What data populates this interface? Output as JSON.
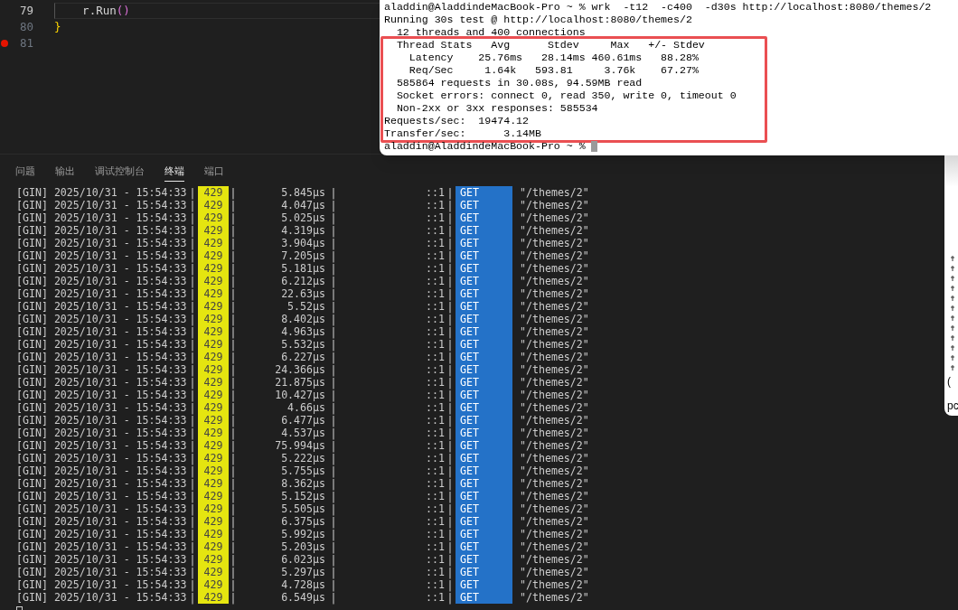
{
  "editor": {
    "lines": [
      {
        "number": "79",
        "current": true,
        "breakpoint": false,
        "tokens": [
          {
            "text": "    r.Run",
            "kind": "plain"
          },
          {
            "text": "()",
            "kind": "paren"
          }
        ]
      },
      {
        "number": "80",
        "current": false,
        "breakpoint": false,
        "tokens": [
          {
            "text": "}",
            "kind": "brace"
          }
        ]
      },
      {
        "number": "81",
        "current": false,
        "breakpoint": true
      }
    ]
  },
  "panel": {
    "tabs": [
      {
        "label": "问题",
        "selected": false
      },
      {
        "label": "输出",
        "selected": false
      },
      {
        "label": "调试控制台",
        "selected": false
      },
      {
        "label": "终端",
        "selected": true
      },
      {
        "label": "端口",
        "selected": false
      }
    ],
    "separator": "|",
    "log": [
      {
        "prefix": "[GIN] 2025/10/31 - 15:54:33",
        "status": "429",
        "latency": "5.845µs",
        "client": "::1",
        "method": "GET",
        "path": "\"/themes/2\""
      },
      {
        "prefix": "[GIN] 2025/10/31 - 15:54:33",
        "status": "429",
        "latency": "4.047µs",
        "client": "::1",
        "method": "GET",
        "path": "\"/themes/2\""
      },
      {
        "prefix": "[GIN] 2025/10/31 - 15:54:33",
        "status": "429",
        "latency": "5.025µs",
        "client": "::1",
        "method": "GET",
        "path": "\"/themes/2\""
      },
      {
        "prefix": "[GIN] 2025/10/31 - 15:54:33",
        "status": "429",
        "latency": "4.319µs",
        "client": "::1",
        "method": "GET",
        "path": "\"/themes/2\""
      },
      {
        "prefix": "[GIN] 2025/10/31 - 15:54:33",
        "status": "429",
        "latency": "3.904µs",
        "client": "::1",
        "method": "GET",
        "path": "\"/themes/2\""
      },
      {
        "prefix": "[GIN] 2025/10/31 - 15:54:33",
        "status": "429",
        "latency": "7.205µs",
        "client": "::1",
        "method": "GET",
        "path": "\"/themes/2\""
      },
      {
        "prefix": "[GIN] 2025/10/31 - 15:54:33",
        "status": "429",
        "latency": "5.181µs",
        "client": "::1",
        "method": "GET",
        "path": "\"/themes/2\""
      },
      {
        "prefix": "[GIN] 2025/10/31 - 15:54:33",
        "status": "429",
        "latency": "6.212µs",
        "client": "::1",
        "method": "GET",
        "path": "\"/themes/2\""
      },
      {
        "prefix": "[GIN] 2025/10/31 - 15:54:33",
        "status": "429",
        "latency": "22.63µs",
        "client": "::1",
        "method": "GET",
        "path": "\"/themes/2\""
      },
      {
        "prefix": "[GIN] 2025/10/31 - 15:54:33",
        "status": "429",
        "latency": "5.52µs",
        "client": "::1",
        "method": "GET",
        "path": "\"/themes/2\""
      },
      {
        "prefix": "[GIN] 2025/10/31 - 15:54:33",
        "status": "429",
        "latency": "8.402µs",
        "client": "::1",
        "method": "GET",
        "path": "\"/themes/2\""
      },
      {
        "prefix": "[GIN] 2025/10/31 - 15:54:33",
        "status": "429",
        "latency": "4.963µs",
        "client": "::1",
        "method": "GET",
        "path": "\"/themes/2\""
      },
      {
        "prefix": "[GIN] 2025/10/31 - 15:54:33",
        "status": "429",
        "latency": "5.532µs",
        "client": "::1",
        "method": "GET",
        "path": "\"/themes/2\""
      },
      {
        "prefix": "[GIN] 2025/10/31 - 15:54:33",
        "status": "429",
        "latency": "6.227µs",
        "client": "::1",
        "method": "GET",
        "path": "\"/themes/2\""
      },
      {
        "prefix": "[GIN] 2025/10/31 - 15:54:33",
        "status": "429",
        "latency": "24.366µs",
        "client": "::1",
        "method": "GET",
        "path": "\"/themes/2\""
      },
      {
        "prefix": "[GIN] 2025/10/31 - 15:54:33",
        "status": "429",
        "latency": "21.875µs",
        "client": "::1",
        "method": "GET",
        "path": "\"/themes/2\""
      },
      {
        "prefix": "[GIN] 2025/10/31 - 15:54:33",
        "status": "429",
        "latency": "10.427µs",
        "client": "::1",
        "method": "GET",
        "path": "\"/themes/2\""
      },
      {
        "prefix": "[GIN] 2025/10/31 - 15:54:33",
        "status": "429",
        "latency": "4.66µs",
        "client": "::1",
        "method": "GET",
        "path": "\"/themes/2\""
      },
      {
        "prefix": "[GIN] 2025/10/31 - 15:54:33",
        "status": "429",
        "latency": "6.477µs",
        "client": "::1",
        "method": "GET",
        "path": "\"/themes/2\""
      },
      {
        "prefix": "[GIN] 2025/10/31 - 15:54:33",
        "status": "429",
        "latency": "4.537µs",
        "client": "::1",
        "method": "GET",
        "path": "\"/themes/2\""
      },
      {
        "prefix": "[GIN] 2025/10/31 - 15:54:33",
        "status": "429",
        "latency": "75.994µs",
        "client": "::1",
        "method": "GET",
        "path": "\"/themes/2\""
      },
      {
        "prefix": "[GIN] 2025/10/31 - 15:54:33",
        "status": "429",
        "latency": "5.222µs",
        "client": "::1",
        "method": "GET",
        "path": "\"/themes/2\""
      },
      {
        "prefix": "[GIN] 2025/10/31 - 15:54:33",
        "status": "429",
        "latency": "5.755µs",
        "client": "::1",
        "method": "GET",
        "path": "\"/themes/2\""
      },
      {
        "prefix": "[GIN] 2025/10/31 - 15:54:33",
        "status": "429",
        "latency": "8.362µs",
        "client": "::1",
        "method": "GET",
        "path": "\"/themes/2\""
      },
      {
        "prefix": "[GIN] 2025/10/31 - 15:54:33",
        "status": "429",
        "latency": "5.152µs",
        "client": "::1",
        "method": "GET",
        "path": "\"/themes/2\""
      },
      {
        "prefix": "[GIN] 2025/10/31 - 15:54:33",
        "status": "429",
        "latency": "5.505µs",
        "client": "::1",
        "method": "GET",
        "path": "\"/themes/2\""
      },
      {
        "prefix": "[GIN] 2025/10/31 - 15:54:33",
        "status": "429",
        "latency": "6.375µs",
        "client": "::1",
        "method": "GET",
        "path": "\"/themes/2\""
      },
      {
        "prefix": "[GIN] 2025/10/31 - 15:54:33",
        "status": "429",
        "latency": "5.992µs",
        "client": "::1",
        "method": "GET",
        "path": "\"/themes/2\""
      },
      {
        "prefix": "[GIN] 2025/10/31 - 15:54:33",
        "status": "429",
        "latency": "5.203µs",
        "client": "::1",
        "method": "GET",
        "path": "\"/themes/2\""
      },
      {
        "prefix": "[GIN] 2025/10/31 - 15:54:33",
        "status": "429",
        "latency": "6.023µs",
        "client": "::1",
        "method": "GET",
        "path": "\"/themes/2\""
      },
      {
        "prefix": "[GIN] 2025/10/31 - 15:54:33",
        "status": "429",
        "latency": "5.297µs",
        "client": "::1",
        "method": "GET",
        "path": "\"/themes/2\""
      },
      {
        "prefix": "[GIN] 2025/10/31 - 15:54:33",
        "status": "429",
        "latency": "4.728µs",
        "client": "::1",
        "method": "GET",
        "path": "\"/themes/2\""
      },
      {
        "prefix": "[GIN] 2025/10/31 - 15:54:33",
        "status": "429",
        "latency": "6.549µs",
        "client": "::1",
        "method": "GET",
        "path": "\"/themes/2\""
      }
    ]
  },
  "terminal_window": {
    "lines": [
      "aladdin@AladdindeMacBook-Pro ~ % wrk  -t12  -c400  -d30s http://localhost:8080/themes/2",
      "Running 30s test @ http://localhost:8080/themes/2",
      "  12 threads and 400 connections"
    ],
    "highlighted_lines": [
      "  Thread Stats   Avg      Stdev     Max   +/- Stdev",
      "    Latency    25.76ms   28.14ms 460.61ms   88.28%",
      "    Req/Sec     1.64k   593.81     3.76k    67.27%",
      "  585864 requests in 30.08s, 94.59MB read",
      "  Socket errors: connect 0, read 350, write 0, timeout 0",
      "  Non-2xx or 3xx responses: 585534",
      "Requests/sec:  19474.12",
      "Transfer/sec:      3.14MB"
    ],
    "prompt": "aladdin@AladdindeMacBook-Pro ~ %"
  },
  "side_window": {
    "fragments": [
      "(",
      "pc"
    ]
  }
}
